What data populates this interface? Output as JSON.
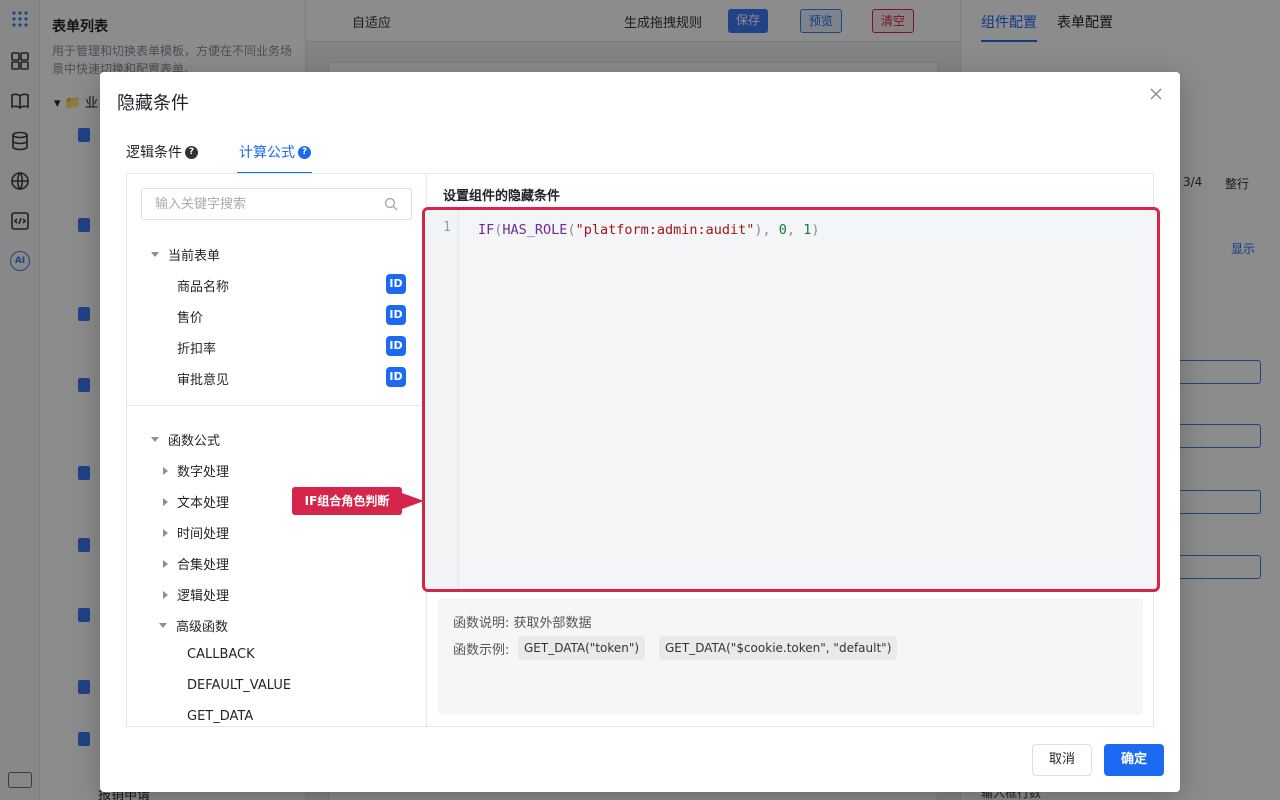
{
  "background": {
    "left_panel": {
      "title": "表单列表",
      "description": "用于管理和切换表单模板，方便在不同业务场景中快速切换和配置表单。",
      "folder_label": "业",
      "last_item": "报销申请"
    },
    "toolbar": {
      "adaptive": "自适应",
      "generate_rules": "生成拖拽规则",
      "save": "保存",
      "preview": "预览",
      "clear": "清空"
    },
    "right_panel": {
      "tab_component": "组件配置",
      "tab_form": "表单配置",
      "ratio": "3/4",
      "whole_row": "整行",
      "show": "显示",
      "rows_hint": "输入框行数"
    }
  },
  "modal": {
    "title": "隐藏条件",
    "tabs": [
      {
        "label": "逻辑条件",
        "active": false
      },
      {
        "label": "计算公式",
        "active": true
      }
    ],
    "search": {
      "placeholder": "输入关键字搜索",
      "value": ""
    },
    "current_form": {
      "label": "当前表单",
      "fields": [
        {
          "label": "商品名称",
          "badge": "ID"
        },
        {
          "label": "售价",
          "badge": "ID"
        },
        {
          "label": "折扣率",
          "badge": "ID"
        },
        {
          "label": "审批意见",
          "badge": "ID"
        }
      ]
    },
    "functions": {
      "label": "函数公式",
      "groups": [
        {
          "label": "数字处理",
          "expanded": false
        },
        {
          "label": "文本处理",
          "expanded": false
        },
        {
          "label": "时间处理",
          "expanded": false
        },
        {
          "label": "合集处理",
          "expanded": false
        },
        {
          "label": "逻辑处理",
          "expanded": false
        },
        {
          "label": "高级函数",
          "expanded": true
        }
      ],
      "advanced_items": [
        "CALLBACK",
        "DEFAULT_VALUE",
        "GET_DATA"
      ]
    },
    "callout": "IF组合角色判断",
    "editor": {
      "title": "设置组件的隐藏条件",
      "line_number": "1",
      "code_tokens": [
        {
          "t": "IF",
          "k": "fn"
        },
        {
          "t": "(",
          "k": "p"
        },
        {
          "t": "HAS_ROLE",
          "k": "fn"
        },
        {
          "t": "(",
          "k": "p"
        },
        {
          "t": "\"platform:admin:audit\"",
          "k": "s"
        },
        {
          "t": "), ",
          "k": "p"
        },
        {
          "t": "0",
          "k": "n"
        },
        {
          "t": ", ",
          "k": "p"
        },
        {
          "t": "1",
          "k": "n"
        },
        {
          "t": ")",
          "k": "p"
        }
      ]
    },
    "help": {
      "description": "函数说明: 获取外部数据",
      "example_label": "函数示例:",
      "examples": [
        "GET_DATA(\"token\")",
        "GET_DATA(\"$cookie.token\", \"default\")"
      ]
    },
    "buttons": {
      "cancel": "取消",
      "confirm": "确定"
    },
    "colors": {
      "accent": "#1d6af2",
      "highlight": "#d6254a"
    }
  }
}
